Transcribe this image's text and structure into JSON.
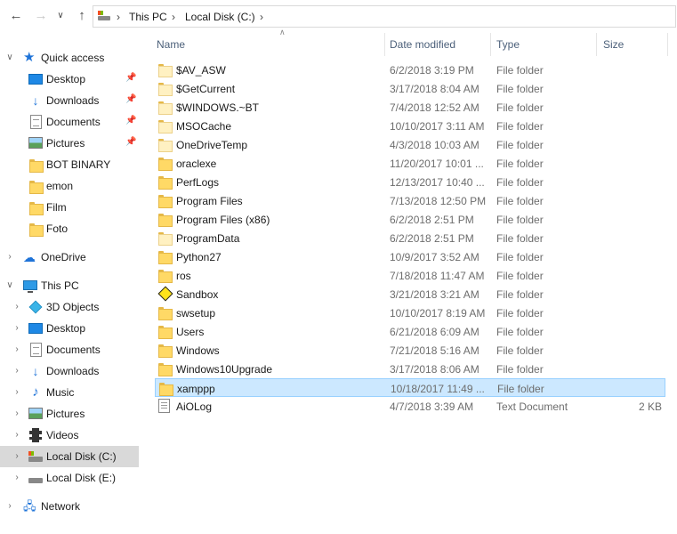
{
  "address": {
    "crumbs": [
      "This PC",
      "Local Disk (C:)"
    ]
  },
  "nav": [
    {
      "label": "Quick access",
      "icon": "star-icon",
      "level": 0,
      "chevron": "expanded"
    },
    {
      "label": "Desktop",
      "icon": "desktop-icon",
      "level": 1,
      "pinned": true
    },
    {
      "label": "Downloads",
      "icon": "download-icon",
      "level": 1,
      "pinned": true
    },
    {
      "label": "Documents",
      "icon": "documents-icon",
      "level": 1,
      "pinned": true
    },
    {
      "label": "Pictures",
      "icon": "pictures-icon",
      "level": 1,
      "pinned": true
    },
    {
      "label": "BOT BINARY",
      "icon": "folder-icon",
      "level": 1
    },
    {
      "label": "emon",
      "icon": "folder-icon",
      "level": 1
    },
    {
      "label": "Film",
      "icon": "folder-icon",
      "level": 1
    },
    {
      "label": "Foto",
      "icon": "folder-icon",
      "level": 1
    },
    {
      "label": "OneDrive",
      "icon": "onedrive-icon",
      "level": 0,
      "chevron": "collapsed"
    },
    {
      "label": "This PC",
      "icon": "this-pc-icon",
      "level": 0,
      "chevron": "expanded"
    },
    {
      "label": "3D Objects",
      "icon": "3d-objects-icon",
      "level": 1,
      "chevron": "collapsed"
    },
    {
      "label": "Desktop",
      "icon": "desktop-icon",
      "level": 1,
      "chevron": "collapsed"
    },
    {
      "label": "Documents",
      "icon": "documents-icon",
      "level": 1,
      "chevron": "collapsed"
    },
    {
      "label": "Downloads",
      "icon": "download-icon",
      "level": 1,
      "chevron": "collapsed"
    },
    {
      "label": "Music",
      "icon": "music-icon",
      "level": 1,
      "chevron": "collapsed"
    },
    {
      "label": "Pictures",
      "icon": "pictures-icon",
      "level": 1,
      "chevron": "collapsed"
    },
    {
      "label": "Videos",
      "icon": "videos-icon",
      "level": 1,
      "chevron": "collapsed"
    },
    {
      "label": "Local Disk (C:)",
      "icon": "windows-drive-icon",
      "level": 1,
      "chevron": "collapsed",
      "selected": true
    },
    {
      "label": "Local Disk (E:)",
      "icon": "drive-icon",
      "level": 1,
      "chevron": "collapsed"
    },
    {
      "label": "Network",
      "icon": "network-icon",
      "level": 0,
      "chevron": "collapsed"
    }
  ],
  "columns": {
    "name": "Name",
    "date": "Date modified",
    "type": "Type",
    "size": "Size"
  },
  "files": [
    {
      "name": "$AV_ASW",
      "date": "6/2/2018 3:19 PM",
      "type": "File folder",
      "size": "",
      "icon": "folder-icon",
      "light": true
    },
    {
      "name": "$GetCurrent",
      "date": "3/17/2018 8:04 AM",
      "type": "File folder",
      "size": "",
      "icon": "folder-icon",
      "light": true
    },
    {
      "name": "$WINDOWS.~BT",
      "date": "7/4/2018 12:52 AM",
      "type": "File folder",
      "size": "",
      "icon": "folder-icon",
      "light": true
    },
    {
      "name": "MSOCache",
      "date": "10/10/2017 3:11 AM",
      "type": "File folder",
      "size": "",
      "icon": "folder-icon",
      "light": true
    },
    {
      "name": "OneDriveTemp",
      "date": "4/3/2018 10:03 AM",
      "type": "File folder",
      "size": "",
      "icon": "folder-icon",
      "light": true
    },
    {
      "name": "oraclexe",
      "date": "11/20/2017 10:01 ...",
      "type": "File folder",
      "size": "",
      "icon": "folder-icon"
    },
    {
      "name": "PerfLogs",
      "date": "12/13/2017 10:40 ...",
      "type": "File folder",
      "size": "",
      "icon": "folder-icon"
    },
    {
      "name": "Program Files",
      "date": "7/13/2018 12:50 PM",
      "type": "File folder",
      "size": "",
      "icon": "folder-icon"
    },
    {
      "name": "Program Files (x86)",
      "date": "6/2/2018 2:51 PM",
      "type": "File folder",
      "size": "",
      "icon": "folder-icon"
    },
    {
      "name": "ProgramData",
      "date": "6/2/2018 2:51 PM",
      "type": "File folder",
      "size": "",
      "icon": "folder-icon",
      "light": true
    },
    {
      "name": "Python27",
      "date": "10/9/2017 3:52 AM",
      "type": "File folder",
      "size": "",
      "icon": "folder-icon"
    },
    {
      "name": "ros",
      "date": "7/18/2018 11:47 AM",
      "type": "File folder",
      "size": "",
      "icon": "folder-icon"
    },
    {
      "name": "Sandbox",
      "date": "3/21/2018 3:21 AM",
      "type": "File folder",
      "size": "",
      "icon": "sandbox-icon"
    },
    {
      "name": "swsetup",
      "date": "10/10/2017 8:19 AM",
      "type": "File folder",
      "size": "",
      "icon": "folder-icon"
    },
    {
      "name": "Users",
      "date": "6/21/2018 6:09 AM",
      "type": "File folder",
      "size": "",
      "icon": "folder-icon"
    },
    {
      "name": "Windows",
      "date": "7/21/2018 5:16 AM",
      "type": "File folder",
      "size": "",
      "icon": "folder-icon"
    },
    {
      "name": "Windows10Upgrade",
      "date": "3/17/2018 8:06 AM",
      "type": "File folder",
      "size": "",
      "icon": "folder-icon"
    },
    {
      "name": "xamppp",
      "date": "10/18/2017 11:49 ...",
      "type": "File folder",
      "size": "",
      "icon": "folder-icon",
      "selected": true
    },
    {
      "name": "AiOLog",
      "date": "4/7/2018 3:39 AM",
      "type": "Text Document",
      "size": "2 KB",
      "icon": "text-document-icon"
    }
  ]
}
